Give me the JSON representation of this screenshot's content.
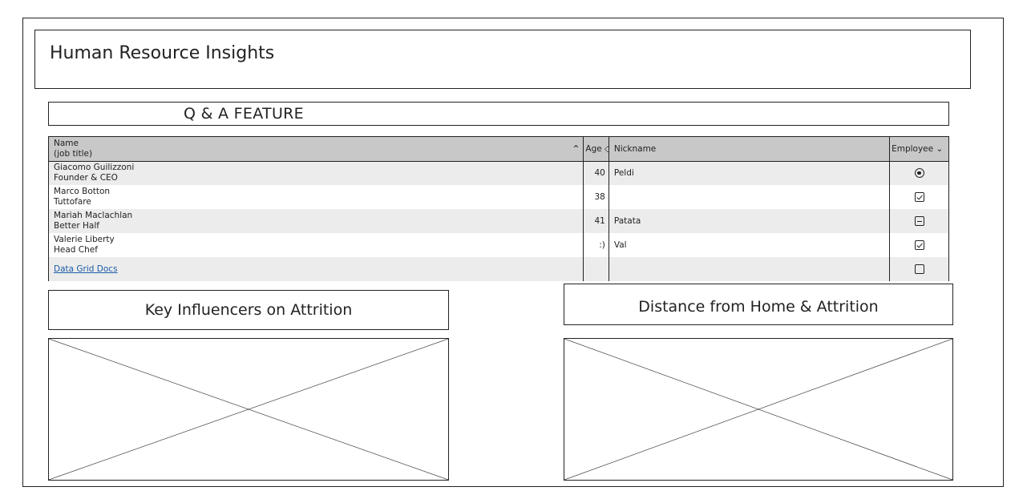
{
  "header": {
    "title": "Human Resource Insights"
  },
  "qa": {
    "title": "Q & A FEATURE"
  },
  "grid": {
    "columns": {
      "name_line1": "Name",
      "name_line2": "(job title)",
      "name_sort_icon": "chevron-up-icon",
      "age": "Age",
      "age_sort_icon": "sort-both-icon",
      "nickname": "Nickname",
      "employee": "Employee",
      "employee_icon": "chevron-down-icon"
    },
    "rows": [
      {
        "name": "Giacomo Guilizzoni",
        "title": "Founder & CEO",
        "age": "40",
        "nickname": "Peldi",
        "employee": "radio-selected"
      },
      {
        "name": "Marco Botton",
        "title": "Tuttofare",
        "age": "38",
        "nickname": "",
        "employee": "checked"
      },
      {
        "name": "Mariah Maclachlan",
        "title": "Better Half",
        "age": "41",
        "nickname": "Patata",
        "employee": "indeterminate"
      },
      {
        "name": "Valerie Liberty",
        "title": "Head Chef",
        "age": ":)",
        "nickname": "Val",
        "employee": "checked"
      }
    ],
    "footer_link": "Data Grid Docs",
    "footer_employee": "unchecked"
  },
  "sections": {
    "key_influencers": "Key Influencers on Attrition",
    "distance_home": "Distance from Home & Attrition"
  }
}
